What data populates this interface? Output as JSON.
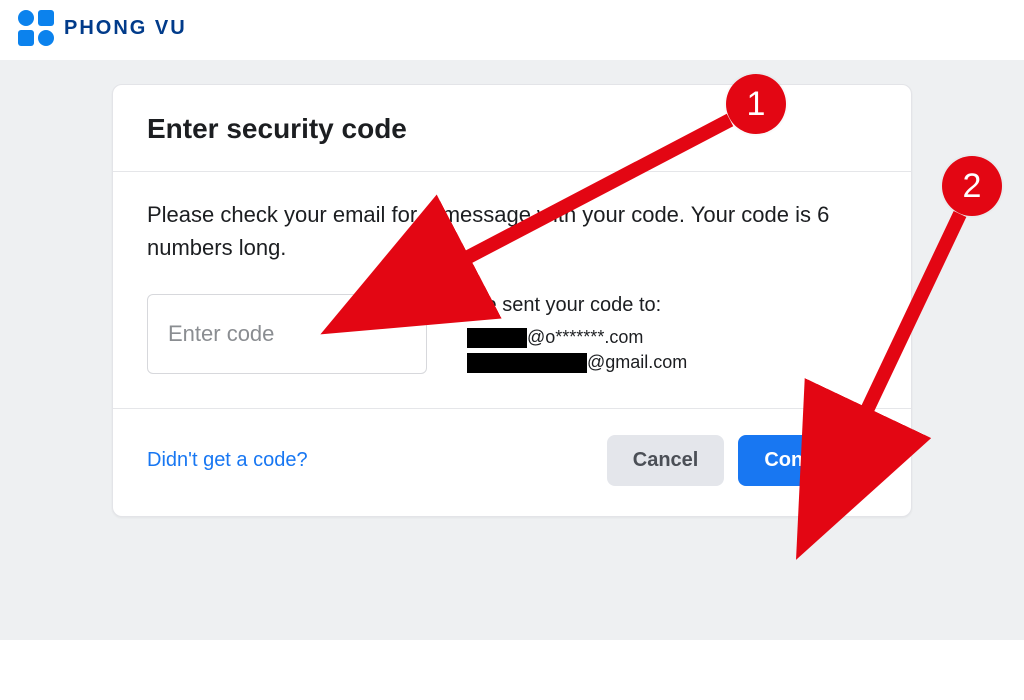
{
  "brand": {
    "name": "PHONG VU"
  },
  "card": {
    "title": "Enter security code",
    "instruction": "Please check your email for a message with your code. Your code is 6 numbers long.",
    "code_placeholder": "Enter code",
    "sent_label": "We sent your code to:",
    "emails": [
      {
        "masked_suffix": "@o*******.com"
      },
      {
        "masked_suffix": "@gmail.com"
      }
    ],
    "help_link": "Didn't get a code?",
    "cancel_label": "Cancel",
    "continue_label": "Continue"
  },
  "annotations": {
    "badge1": "1",
    "badge2": "2"
  }
}
